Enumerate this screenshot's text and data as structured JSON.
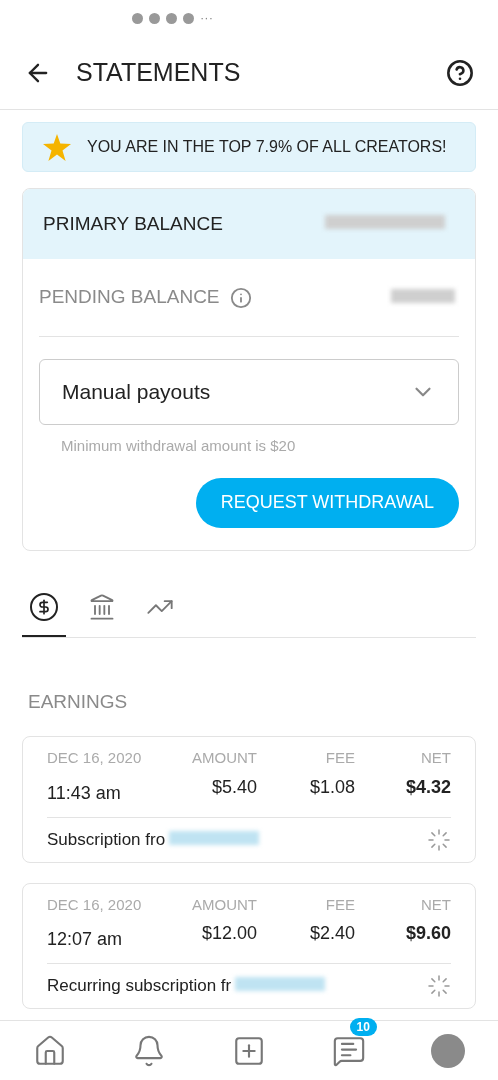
{
  "status_bar": {
    "more": "···"
  },
  "header": {
    "title": "STATEMENTS"
  },
  "banner": {
    "text": "YOU ARE IN THE TOP 7.9% OF ALL CREATORS!"
  },
  "balance_card": {
    "primary_label": "PRIMARY BALANCE",
    "pending_label": "PENDING BALANCE",
    "payout_select": {
      "value": "Manual payouts"
    },
    "hint": "Minimum withdrawal amount is $20",
    "button": "REQUEST WITHDRAWAL"
  },
  "tabs": [
    {
      "kind": "dollar",
      "selected": true
    },
    {
      "kind": "bank",
      "selected": false
    },
    {
      "kind": "chart",
      "selected": false
    }
  ],
  "section_title": "EARNINGS",
  "transactions": [
    {
      "date": "DEC 16, 2020",
      "time": "11:43 am",
      "amount_label": "AMOUNT",
      "amount": "$5.40",
      "fee_label": "FEE",
      "fee": "$1.08",
      "net_label": "NET",
      "net": "$4.32",
      "description": "Subscription fro"
    },
    {
      "date": "DEC 16, 2020",
      "time": "12:07 am",
      "amount_label": "AMOUNT",
      "amount": "$12.00",
      "fee_label": "FEE",
      "fee": "$2.40",
      "net_label": "NET",
      "net": "$9.60",
      "description": "Recurring subscription fr"
    }
  ],
  "nav": {
    "messages_badge": "10"
  }
}
